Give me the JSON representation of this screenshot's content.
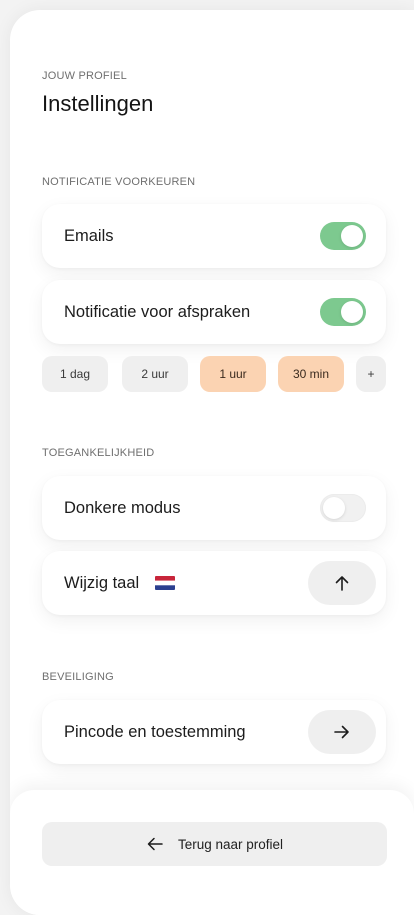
{
  "header": {
    "overline": "JOUW PROFIEL",
    "title": "Instellingen"
  },
  "notifications": {
    "section_title": "NOTIFICATIE VOORKEUREN",
    "emails": {
      "label": "Emails",
      "enabled": true
    },
    "appointments": {
      "label": "Notificatie voor afspraken",
      "enabled": true
    },
    "reminder_options": [
      {
        "label": "1 dag",
        "selected": false
      },
      {
        "label": "2 uur",
        "selected": false
      },
      {
        "label": "1 uur",
        "selected": true
      },
      {
        "label": "30 min",
        "selected": true
      },
      {
        "label": "+",
        "selected": false
      }
    ]
  },
  "accessibility": {
    "section_title": "TOEGANKELIJKHEID",
    "dark_mode": {
      "label": "Donkere modus",
      "enabled": false
    },
    "language": {
      "label": "Wijzig taal",
      "flag_icon": "netherlands-flag-icon",
      "action_icon": "arrow-up-icon"
    }
  },
  "security": {
    "section_title": "BEVEILIGING",
    "pincode": {
      "label": "Pincode en toestemming",
      "action_icon": "arrow-right-icon"
    }
  },
  "footer": {
    "back_label": "Terug naar profiel",
    "back_icon": "arrow-left-icon"
  },
  "colors": {
    "toggle_on": "#7dc98f",
    "chip_selected": "#fbd3b2",
    "chip_default": "#efefef"
  }
}
